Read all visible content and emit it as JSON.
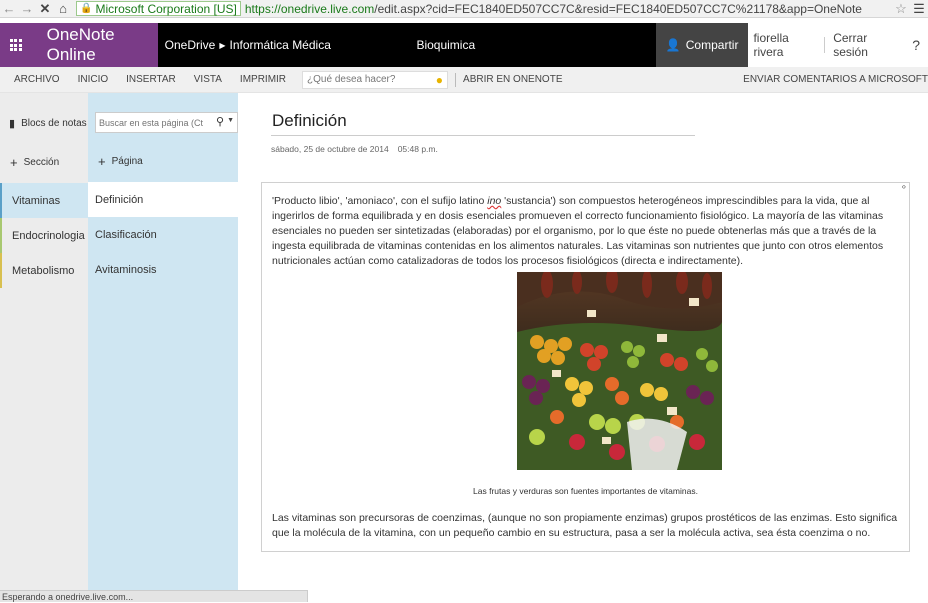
{
  "browser": {
    "back_icon": "back-arrow-icon",
    "forward_icon": "forward-arrow-icon",
    "stop_icon": "stop-icon",
    "home_icon": "home-icon",
    "ev_cert": "Microsoft Corporation [US]",
    "url_scheme_host": "https://onedrive.live.com",
    "url_path": "/edit.aspx?cid=FEC1840ED507CC7C&resid=FEC1840ED507CC7C%21178&app=OneNote"
  },
  "app_bar": {
    "app_name": "OneNote Online",
    "breadcrumb_root": "OneDrive",
    "breadcrumb_folder": "Informática Médica",
    "document_title": "Bioquimica",
    "share_label": "Compartir",
    "user_name": "fiorella rivera",
    "signout_label": "Cerrar sesión",
    "help_label": "?"
  },
  "ribbon": {
    "tabs": [
      "ARCHIVO",
      "INICIO",
      "INSERTAR",
      "VISTA",
      "IMPRIMIR"
    ],
    "tell_me_placeholder": "¿Qué desea hacer?",
    "open_in_onenote": "ABRIR EN ONENOTE",
    "feedback": "ENVIAR COMENTARIOS A MICROSOFT"
  },
  "sections_pane": {
    "notebooks_label": "Blocs de notas",
    "add_section_label": "Sección",
    "sections": [
      {
        "label": "Vitaminas",
        "active": true,
        "color": "#5aa0c8"
      },
      {
        "label": "Endocrinologia",
        "active": false,
        "color": "#a8c870"
      },
      {
        "label": "Metabolismo",
        "active": false,
        "color": "#d8c050"
      }
    ]
  },
  "pages_pane": {
    "search_placeholder": "Buscar en esta página (Ctrl+E)",
    "add_page_label": "Página",
    "pages": [
      {
        "label": "Definición",
        "active": true
      },
      {
        "label": "Clasificación",
        "active": false
      },
      {
        "label": "Avitaminosis",
        "active": false
      }
    ]
  },
  "page": {
    "title": "Definición",
    "date": "sábado, 25 de octubre de 2014",
    "time": "05:48 p.m.",
    "para1_before": "'Producto libio', 'amoniaco', con el sufijo latino ",
    "para1_italic": "ino",
    "para1_after": " 'sustancia') son compuestos heterogéneos imprescindibles para la vida, que al ingerirlos de forma equilibrada y en dosis esenciales promueven el correcto funcionamiento fisiológico. La mayoría de las vitaminas esenciales no pueden ser sintetizadas (elaboradas) por el organismo, por lo que éste no puede obtenerlas más que a través de la ingesta equilibrada de vitaminas contenidas en los alimentos naturales. Las vitaminas son nutrientes que junto con otros elementos nutricionales actúan como catalizadoras de todos los procesos fisiológicos (directa e indirectamente).",
    "image_caption": "Las frutas y verduras son fuentes importantes de vitaminas.",
    "para2": "Las vitaminas son precursoras de coenzimas, (aunque no son propiamente enzimas) grupos prostéticos de las enzimas. Esto significa que la molécula de la vitamina, con un pequeño cambio en su estructura, pasa a ser la molécula activa, sea ésta coenzima o no."
  },
  "status_bar": {
    "text": "Esperando a onedrive.live.com..."
  },
  "colors": {
    "onenote_purple": "#7a3b87",
    "app_bar_bg": "#000000",
    "pages_pane_bg": "#cfe6f2",
    "sections_pane_bg": "#ececec"
  }
}
